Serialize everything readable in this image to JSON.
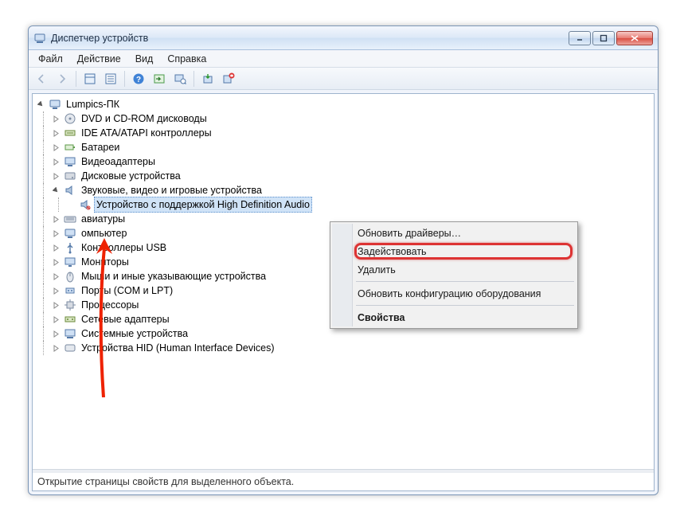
{
  "window": {
    "title": "Диспетчер устройств"
  },
  "menu": {
    "file": "Файл",
    "action": "Действие",
    "view": "Вид",
    "help": "Справка"
  },
  "tree": {
    "root": "Lumpics-ПК",
    "items": [
      "DVD и CD-ROM дисководы",
      "IDE ATA/ATAPI контроллеры",
      "Батареи",
      "Видеоадаптеры",
      "Дисковые устройства",
      "Звуковые, видео и игровые устройства",
      "авиатуры",
      "омпьютер",
      "Контроллеры USB",
      "Мониторы",
      "Мыши и иные указывающие устройства",
      "Порты (COM и LPT)",
      "Процессоры",
      "Сетевые адаптеры",
      "Системные устройства",
      "Устройства HID (Human Interface Devices)"
    ],
    "audio_child": "Устройство с поддержкой High Definition Audio"
  },
  "context": {
    "update": "Обновить драйверы…",
    "enable": "Задействовать",
    "delete": "Удалить",
    "refresh": "Обновить конфигурацию оборудования",
    "props": "Свойства"
  },
  "status": "Открытие страницы свойств для выделенного объекта."
}
